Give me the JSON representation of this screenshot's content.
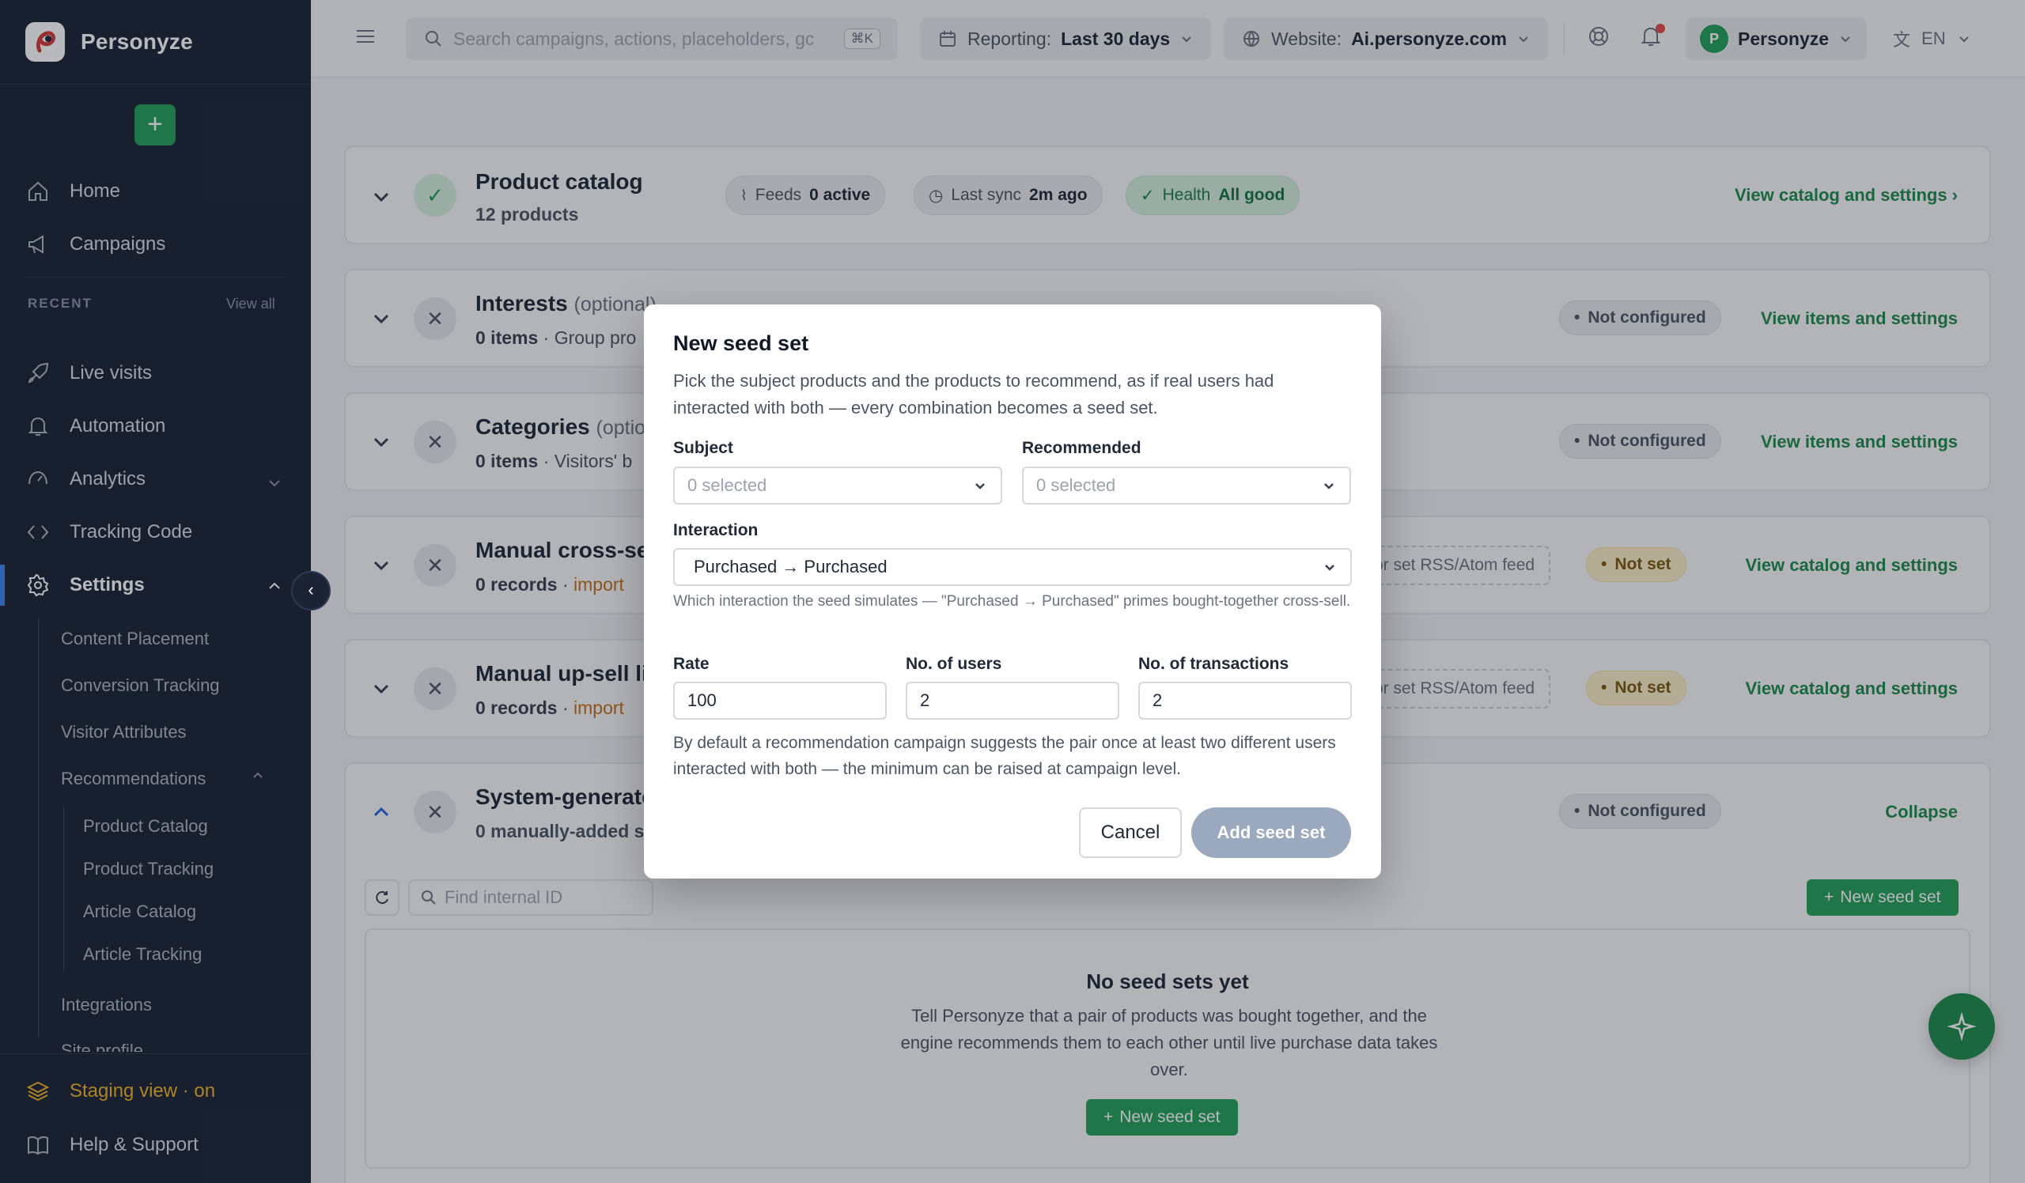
{
  "brand": {
    "name": "Personyze"
  },
  "sidebar": {
    "nav": [
      {
        "label": "Home",
        "icon": "home-icon"
      },
      {
        "label": "Campaigns",
        "icon": "megaphone-icon"
      }
    ],
    "recent_label": "RECENT",
    "view_all": "View all",
    "recent": [
      {
        "label": "Live visits",
        "icon": "rocket-icon"
      },
      {
        "label": "Automation",
        "icon": "bell-icon"
      },
      {
        "label": "Analytics",
        "icon": "gauge-icon"
      },
      {
        "label": "Tracking Code",
        "icon": "code-icon"
      },
      {
        "label": "Settings",
        "icon": "gear-icon"
      }
    ],
    "settings_sub": [
      "Content Placement",
      "Conversion Tracking",
      "Visitor Attributes",
      "Recommendations"
    ],
    "recommendations_sub": [
      "Product Catalog",
      "Product Tracking",
      "Article Catalog",
      "Article Tracking"
    ],
    "settings_sub2": [
      "Integrations",
      "Site profile"
    ],
    "staging": "Staging view · on",
    "help": "Help & Support"
  },
  "topbar": {
    "search_placeholder": "Search campaigns, actions, placeholders, gc",
    "search_kbd": "⌘K",
    "reporting_label": "Reporting:",
    "reporting_value": "Last 30 days",
    "website_label": "Website:",
    "website_value": "Ai.personyze.com",
    "account": "Personyze",
    "account_initial": "P",
    "lang": "EN"
  },
  "cards": {
    "catalog": {
      "title": "Product catalog",
      "sub": "12 products",
      "feeds_label": "Feeds",
      "feeds_value": "0 active",
      "sync_label": "Last sync",
      "sync_value": "2m ago",
      "health_label": "Health",
      "health_value": "All good",
      "link": "View catalog and settings ›"
    },
    "interests": {
      "title": "Interests",
      "optional": "(optional)",
      "count": "0 items",
      "desc": "Group pro",
      "status": "Not configured",
      "link": "View items and settings"
    },
    "categories": {
      "title": "Categories",
      "optional": "(optio",
      "count": "0 items",
      "desc": "Visitors' b",
      "status": "Not configured",
      "link": "View items and settings"
    },
    "crosssell": {
      "title": "Manual cross-se",
      "count": "0 records",
      "import": "import",
      "feed": "or set RSS/Atom feed",
      "status": "Not set",
      "link": "View catalog and settings"
    },
    "upsell": {
      "title": "Manual up-sell li",
      "count": "0 records",
      "import": "import",
      "feed": "or set RSS/Atom feed",
      "status": "Not set",
      "link": "View catalog and settings"
    },
    "system": {
      "title": "System-generate",
      "count": "0 manually-added s",
      "status": "Not configured",
      "link": "Collapse"
    }
  },
  "seeds": {
    "find_placeholder": "Find internal ID",
    "new_button": "New seed set",
    "empty_title": "No seed sets yet",
    "empty_text": "Tell Personyze that a pair of products was bought together, and the engine recommends them to each other until live purchase data takes over.",
    "empty_button": "New seed set"
  },
  "modal": {
    "title": "New seed set",
    "description": "Pick the subject products and the products to recommend, as if real users had interacted with both — every combination becomes a seed set.",
    "subject_label": "Subject",
    "subject_value": "0 selected",
    "recommended_label": "Recommended",
    "recommended_value": "0 selected",
    "interaction_label": "Interaction",
    "interaction_value": "Purchased → Purchased",
    "interaction_help": "Which interaction the seed simulates — \"Purchased → Purchased\" primes bought-together cross-sell.",
    "rate_label": "Rate",
    "rate_value": "100",
    "users_label": "No. of users",
    "users_value": "2",
    "transactions_label": "No. of transactions",
    "transactions_value": "2",
    "note": "By default a recommendation campaign suggests the pair once at least two different users interacted with both — the minimum can be raised at campaign level.",
    "cancel": "Cancel",
    "add": "Add seed set"
  }
}
